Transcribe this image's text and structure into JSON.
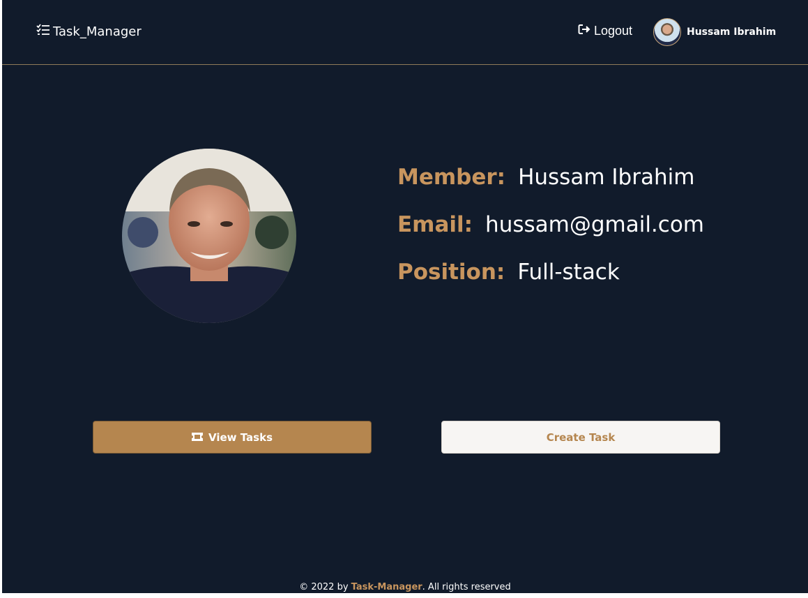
{
  "navbar": {
    "brand": "Task_Manager",
    "brand_icon": "task-list-icon",
    "logout_label": "Logout",
    "logout_icon": "logout-icon",
    "user_name": "Hussam Ibrahim"
  },
  "profile": {
    "member_label": "Member:",
    "member_value": "Hussam Ibrahim",
    "email_label": "Email:",
    "email_value": "hussam@gmail.com",
    "position_label": "Position:",
    "position_value": "Full-stack"
  },
  "actions": {
    "view_tasks_label": "View Tasks",
    "view_tasks_icon": "ticket-icon",
    "create_task_label": "Create Task"
  },
  "footer": {
    "prefix": "© 2022 by ",
    "brand": "Task-Manager",
    "suffix": ". All rights reserved"
  },
  "colors": {
    "background": "#111b2b",
    "accent": "#c8955e",
    "button_primary": "#b5864f",
    "button_secondary": "#f7f5f3"
  }
}
